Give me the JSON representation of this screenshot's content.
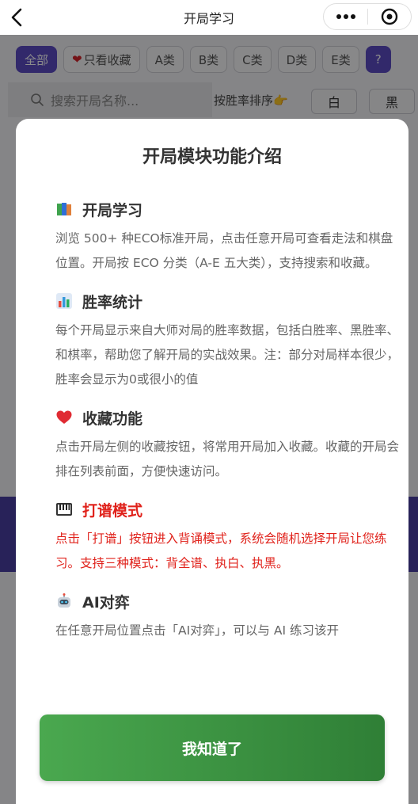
{
  "navbar": {
    "title": "开局学习"
  },
  "filters": {
    "all": "全部",
    "favorites": "只看收藏",
    "classes": [
      "A类",
      "B类",
      "C类",
      "D类",
      "E类"
    ],
    "help": "?"
  },
  "search": {
    "placeholder": "搜索开局名称..."
  },
  "sort": {
    "label": "按胜率排序👉",
    "white": "白",
    "black": "黑"
  },
  "modal": {
    "title": "开局模块功能介绍",
    "sections": [
      {
        "icon": "books-icon",
        "title": "开局学习",
        "body": "浏览 500+ 种ECO标准开局，点击任意开局可查看走法和棋盘位置。开局按 ECO 分类（A-E 五大类），支持搜索和收藏。"
      },
      {
        "icon": "bar-chart-icon",
        "title": "胜率统计",
        "body": "每个开局显示来自大师对局的胜率数据，包括白胜率、黑胜率、和棋率，帮助您了解开局的实战效果。注：部分对局样本很少，胜率会显示为0或很小的值"
      },
      {
        "icon": "heart-icon",
        "title": "收藏功能",
        "body": "点击开局左侧的收藏按钮，将常用开局加入收藏。收藏的开局会排在列表前面，方便快速访问。"
      },
      {
        "icon": "piano-icon",
        "title": "打谱模式",
        "body": "点击「打谱」按钮进入背诵模式，系统会随机选择开局让您练习。支持三种模式：背全谱、执白、执黑。"
      },
      {
        "icon": "robot-icon",
        "title": "AI对弈",
        "body": "在任意开局位置点击「AI对弈」，可以与 AI 练习该开"
      }
    ],
    "ok_label": "我知道了"
  },
  "colors": {
    "accent": "#5b4bc4",
    "highlight": "#e0221b",
    "button_start": "#4aa84f",
    "button_end": "#2f7f36"
  }
}
